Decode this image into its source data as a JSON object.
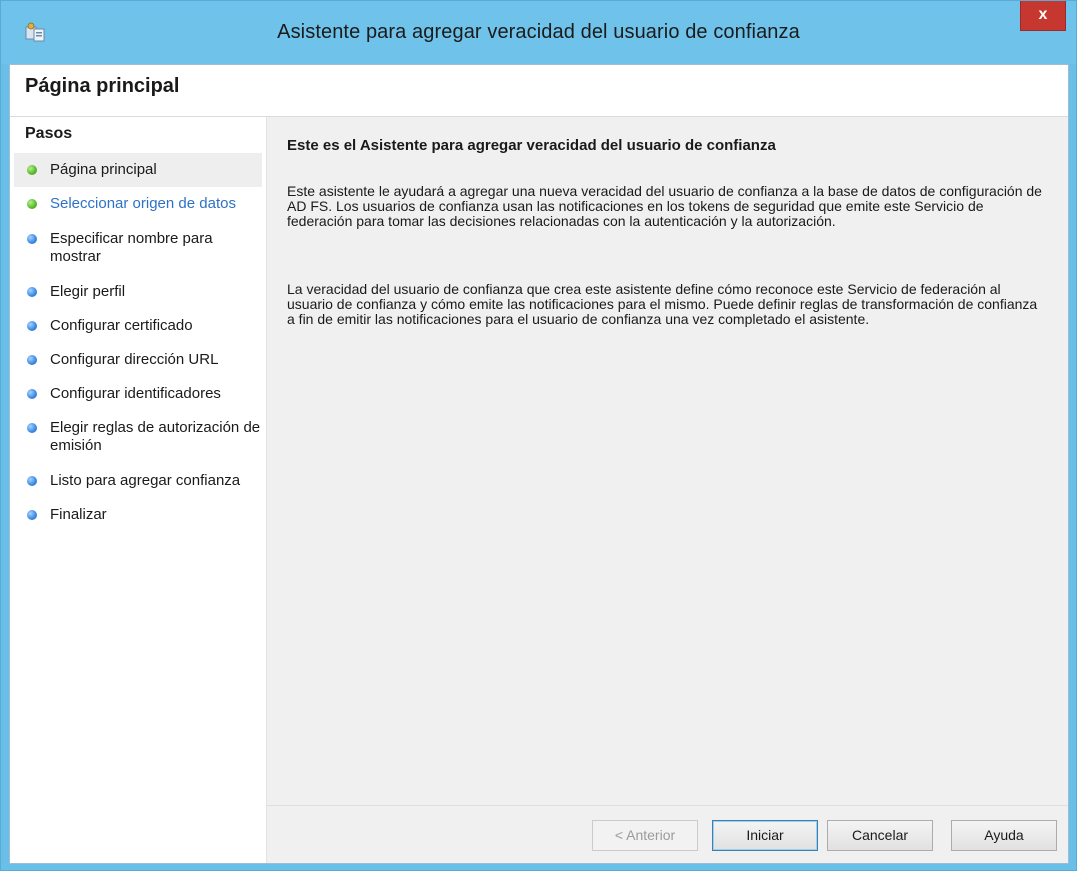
{
  "window": {
    "title": "Asistente para agregar veracidad del usuario de confianza",
    "close_label": "x"
  },
  "header": {
    "title": "Página principal"
  },
  "sidebar": {
    "heading": "Pasos",
    "steps": [
      {
        "label": "Página principal",
        "status": "completed"
      },
      {
        "label": "Seleccionar origen de datos",
        "status": "next"
      },
      {
        "label": "Especificar nombre para mostrar",
        "status": "pending"
      },
      {
        "label": "Elegir perfil",
        "status": "pending"
      },
      {
        "label": "Configurar certificado",
        "status": "pending"
      },
      {
        "label": "Configurar dirección URL",
        "status": "pending"
      },
      {
        "label": "Configurar identificadores",
        "status": "pending"
      },
      {
        "label": "Elegir reglas de autorización de emisión",
        "status": "pending"
      },
      {
        "label": "Listo para agregar confianza",
        "status": "pending"
      },
      {
        "label": "Finalizar",
        "status": "pending"
      }
    ]
  },
  "content": {
    "title": "Este es el Asistente para agregar veracidad del usuario de confianza",
    "paragraph1": "Este asistente le ayudará a agregar una nueva veracidad del usuario de confianza a la base de datos de configuración de AD FS. Los usuarios de confianza usan las notificaciones en los tokens de seguridad que emite este Servicio de federación para tomar las decisiones relacionadas con la autenticación y la autorización.",
    "paragraph2": "La veracidad del usuario de confianza que crea este asistente define cómo reconoce este Servicio de federación al usuario de confianza y cómo emite las notificaciones para el mismo. Puede definir reglas de transformación de confianza a fin de emitir las notificaciones para el usuario de confianza una vez completado el asistente."
  },
  "footer": {
    "back_label": "< Anterior",
    "start_label": "Iniciar",
    "cancel_label": "Cancelar",
    "help_label": "Ayuda"
  },
  "colors": {
    "titlebar": "#6fc3ea",
    "close": "#c6372f",
    "link": "#2d72c6",
    "completed_dot": "#5dbb31",
    "pending_dot": "#3f8de6"
  }
}
